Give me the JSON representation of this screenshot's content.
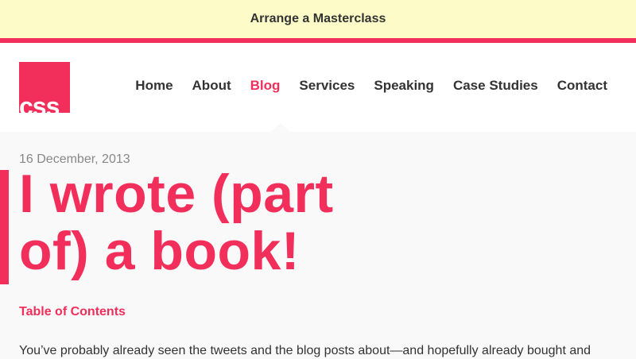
{
  "promo": {
    "label": "Arrange a Masterclass",
    "border_color": "#f22e5b",
    "background": "#fdfcc8"
  },
  "logo": {
    "text": "css",
    "color": "#f22e5b"
  },
  "nav": {
    "items": [
      "Home",
      "About",
      "Blog",
      "Services",
      "Speaking",
      "Case Studies",
      "Contact"
    ],
    "active": "Blog"
  },
  "post": {
    "date": "16 December, 2013",
    "title": "I wrote (part of) a book!",
    "toc_label": "Table of Contents",
    "intro": "You’ve probably already seen the tweets and the blog posts about—and hopefully already bought and"
  },
  "colors": {
    "accent": "#f22e5b",
    "text": "#333333",
    "muted": "#888888"
  }
}
